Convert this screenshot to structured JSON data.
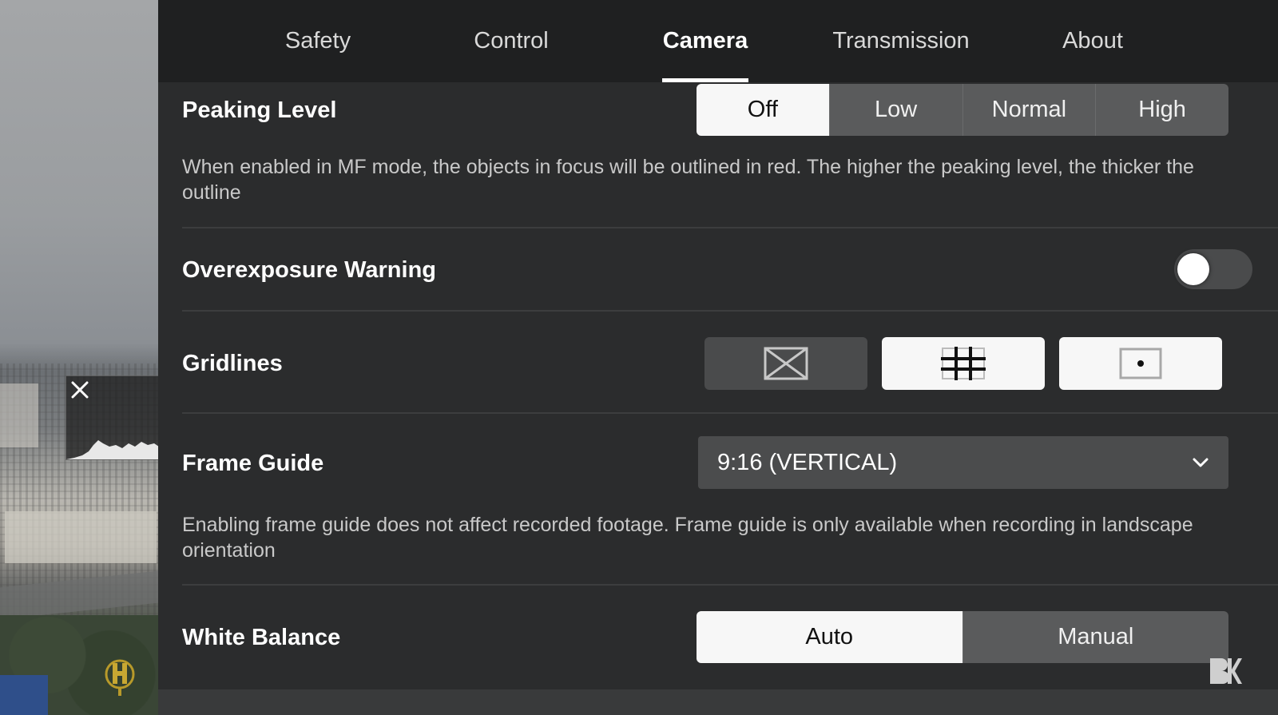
{
  "tabs": [
    {
      "label": "Safety",
      "active": false
    },
    {
      "label": "Control",
      "active": false
    },
    {
      "label": "Camera",
      "active": true
    },
    {
      "label": "Transmission",
      "active": false
    },
    {
      "label": "About",
      "active": false
    }
  ],
  "peaking_level": {
    "label": "Peaking Level",
    "options": [
      "Off",
      "Low",
      "Normal",
      "High"
    ],
    "selected": "Off",
    "description": "When enabled in MF mode, the objects in focus will be outlined in red. The higher the peaking level, the thicker the outline"
  },
  "overexposure_warning": {
    "label": "Overexposure Warning",
    "enabled": false
  },
  "gridlines": {
    "label": "Gridlines",
    "options": [
      {
        "icon": "diagonal-grid-icon",
        "selected": false
      },
      {
        "icon": "grid-3x3-icon",
        "selected": true
      },
      {
        "icon": "center-point-icon",
        "selected": true
      }
    ]
  },
  "frame_guide": {
    "label": "Frame Guide",
    "value": "9:16 (VERTICAL)",
    "description": "Enabling frame guide does not affect recorded footage. Frame guide is only available when recording in landscape orientation"
  },
  "white_balance": {
    "label": "White Balance",
    "options": [
      "Auto",
      "Manual"
    ],
    "selected": "Auto"
  },
  "preview": {
    "histogram_close_icon": "close-icon"
  }
}
